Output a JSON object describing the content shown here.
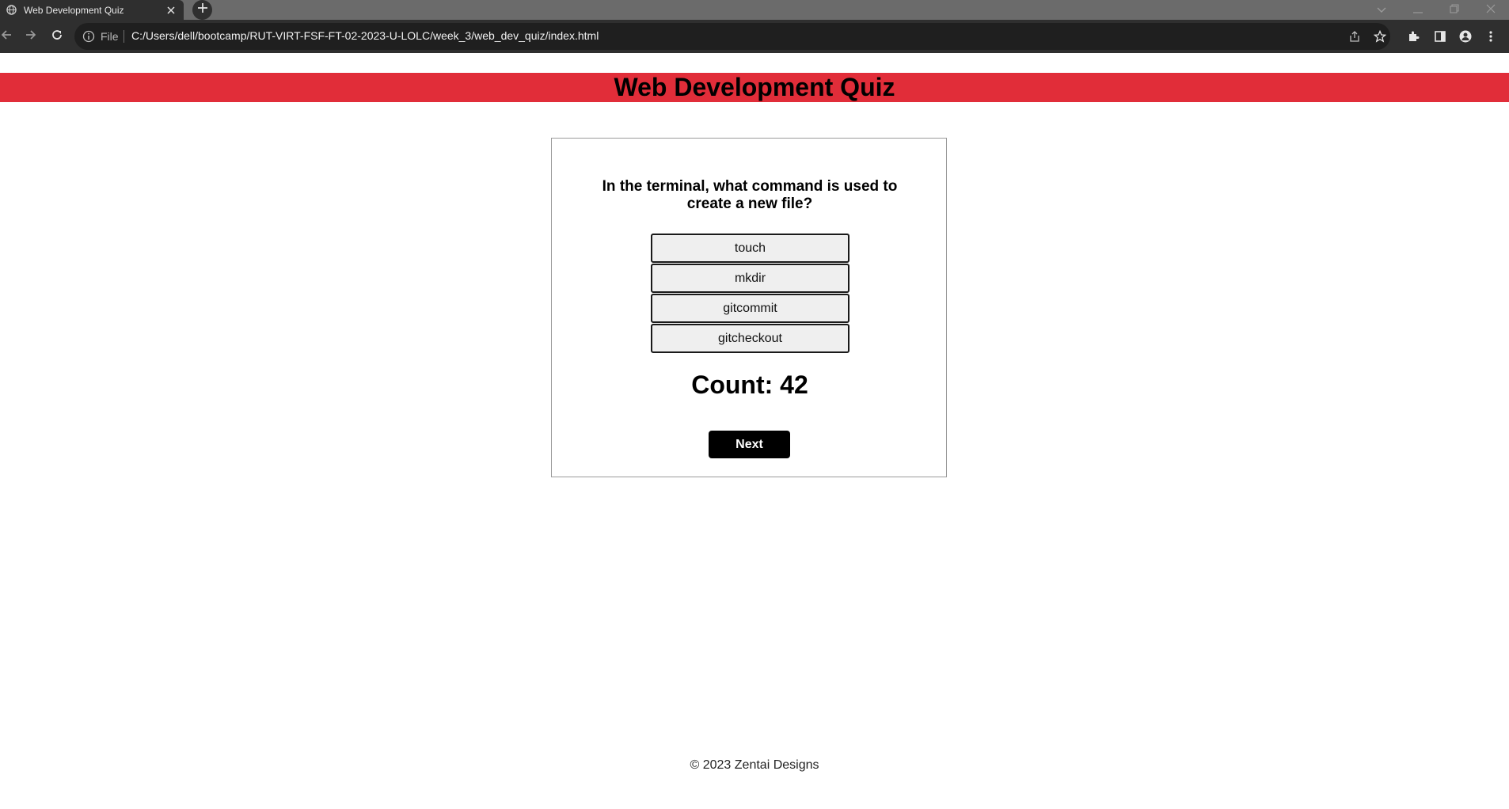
{
  "browser": {
    "tab_title": "Web Development Quiz",
    "scheme_label": "File",
    "url": "C:/Users/dell/bootcamp/RUT-VIRT-FSF-FT-02-2023-U-LOLC/week_3/web_dev_quiz/index.html",
    "icons": [
      "globe-icon",
      "close-icon",
      "plus-icon",
      "chevron-down-icon",
      "minimize-icon",
      "restore-icon",
      "window-close-icon",
      "back-arrow-icon",
      "forward-arrow-icon",
      "reload-icon",
      "info-icon",
      "share-icon",
      "star-icon",
      "extensions-icon",
      "side-panel-icon",
      "profile-icon",
      "kebab-menu-icon"
    ]
  },
  "page": {
    "header_title": "Web Development Quiz",
    "header_color": "#e12d39",
    "question": "In the terminal, what command is used to create a new file?",
    "answers": [
      "touch",
      "mkdir",
      "gitcommit",
      "gitcheckout"
    ],
    "count_label": "Count: 42",
    "next_label": "Next",
    "footer": "© 2023 Zentai Designs"
  }
}
